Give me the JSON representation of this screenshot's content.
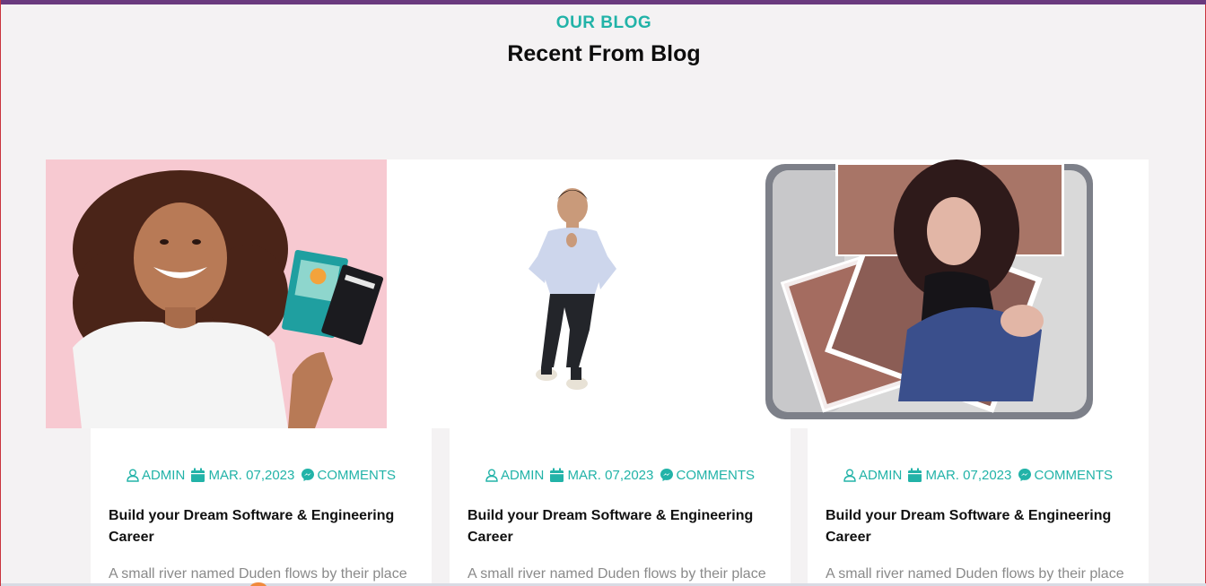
{
  "section": {
    "eyebrow": "OUR BLOG",
    "title": "Recent From Blog"
  },
  "colors": {
    "accent": "#22b3a8",
    "background": "#f4f2f3",
    "card": "#ffffff",
    "title": "#111111",
    "excerpt": "#8a8a8a"
  },
  "posts": [
    {
      "image": "woman-with-passport",
      "author": "ADMIN",
      "date": "MAR. 07,2023",
      "comments": "COMMENTS",
      "title": "Build your Dream Software & Engineering Career",
      "excerpt": "A small river named Duden flows by their place"
    },
    {
      "image": "man-in-shirt",
      "author": "ADMIN",
      "date": "MAR. 07,2023",
      "comments": "COMMENTS",
      "title": "Build your Dream Software & Engineering Career",
      "excerpt": "A small river named Duden flows by their place"
    },
    {
      "image": "photo-wallet",
      "author": "ADMIN",
      "date": "MAR. 07,2023",
      "comments": "COMMENTS",
      "title": "Build your Dream Software & Engineering Career",
      "excerpt": "A small river named Duden flows by their place"
    }
  ],
  "icons": {
    "author": "user-icon",
    "date": "calendar-icon",
    "comments": "messenger-icon"
  }
}
